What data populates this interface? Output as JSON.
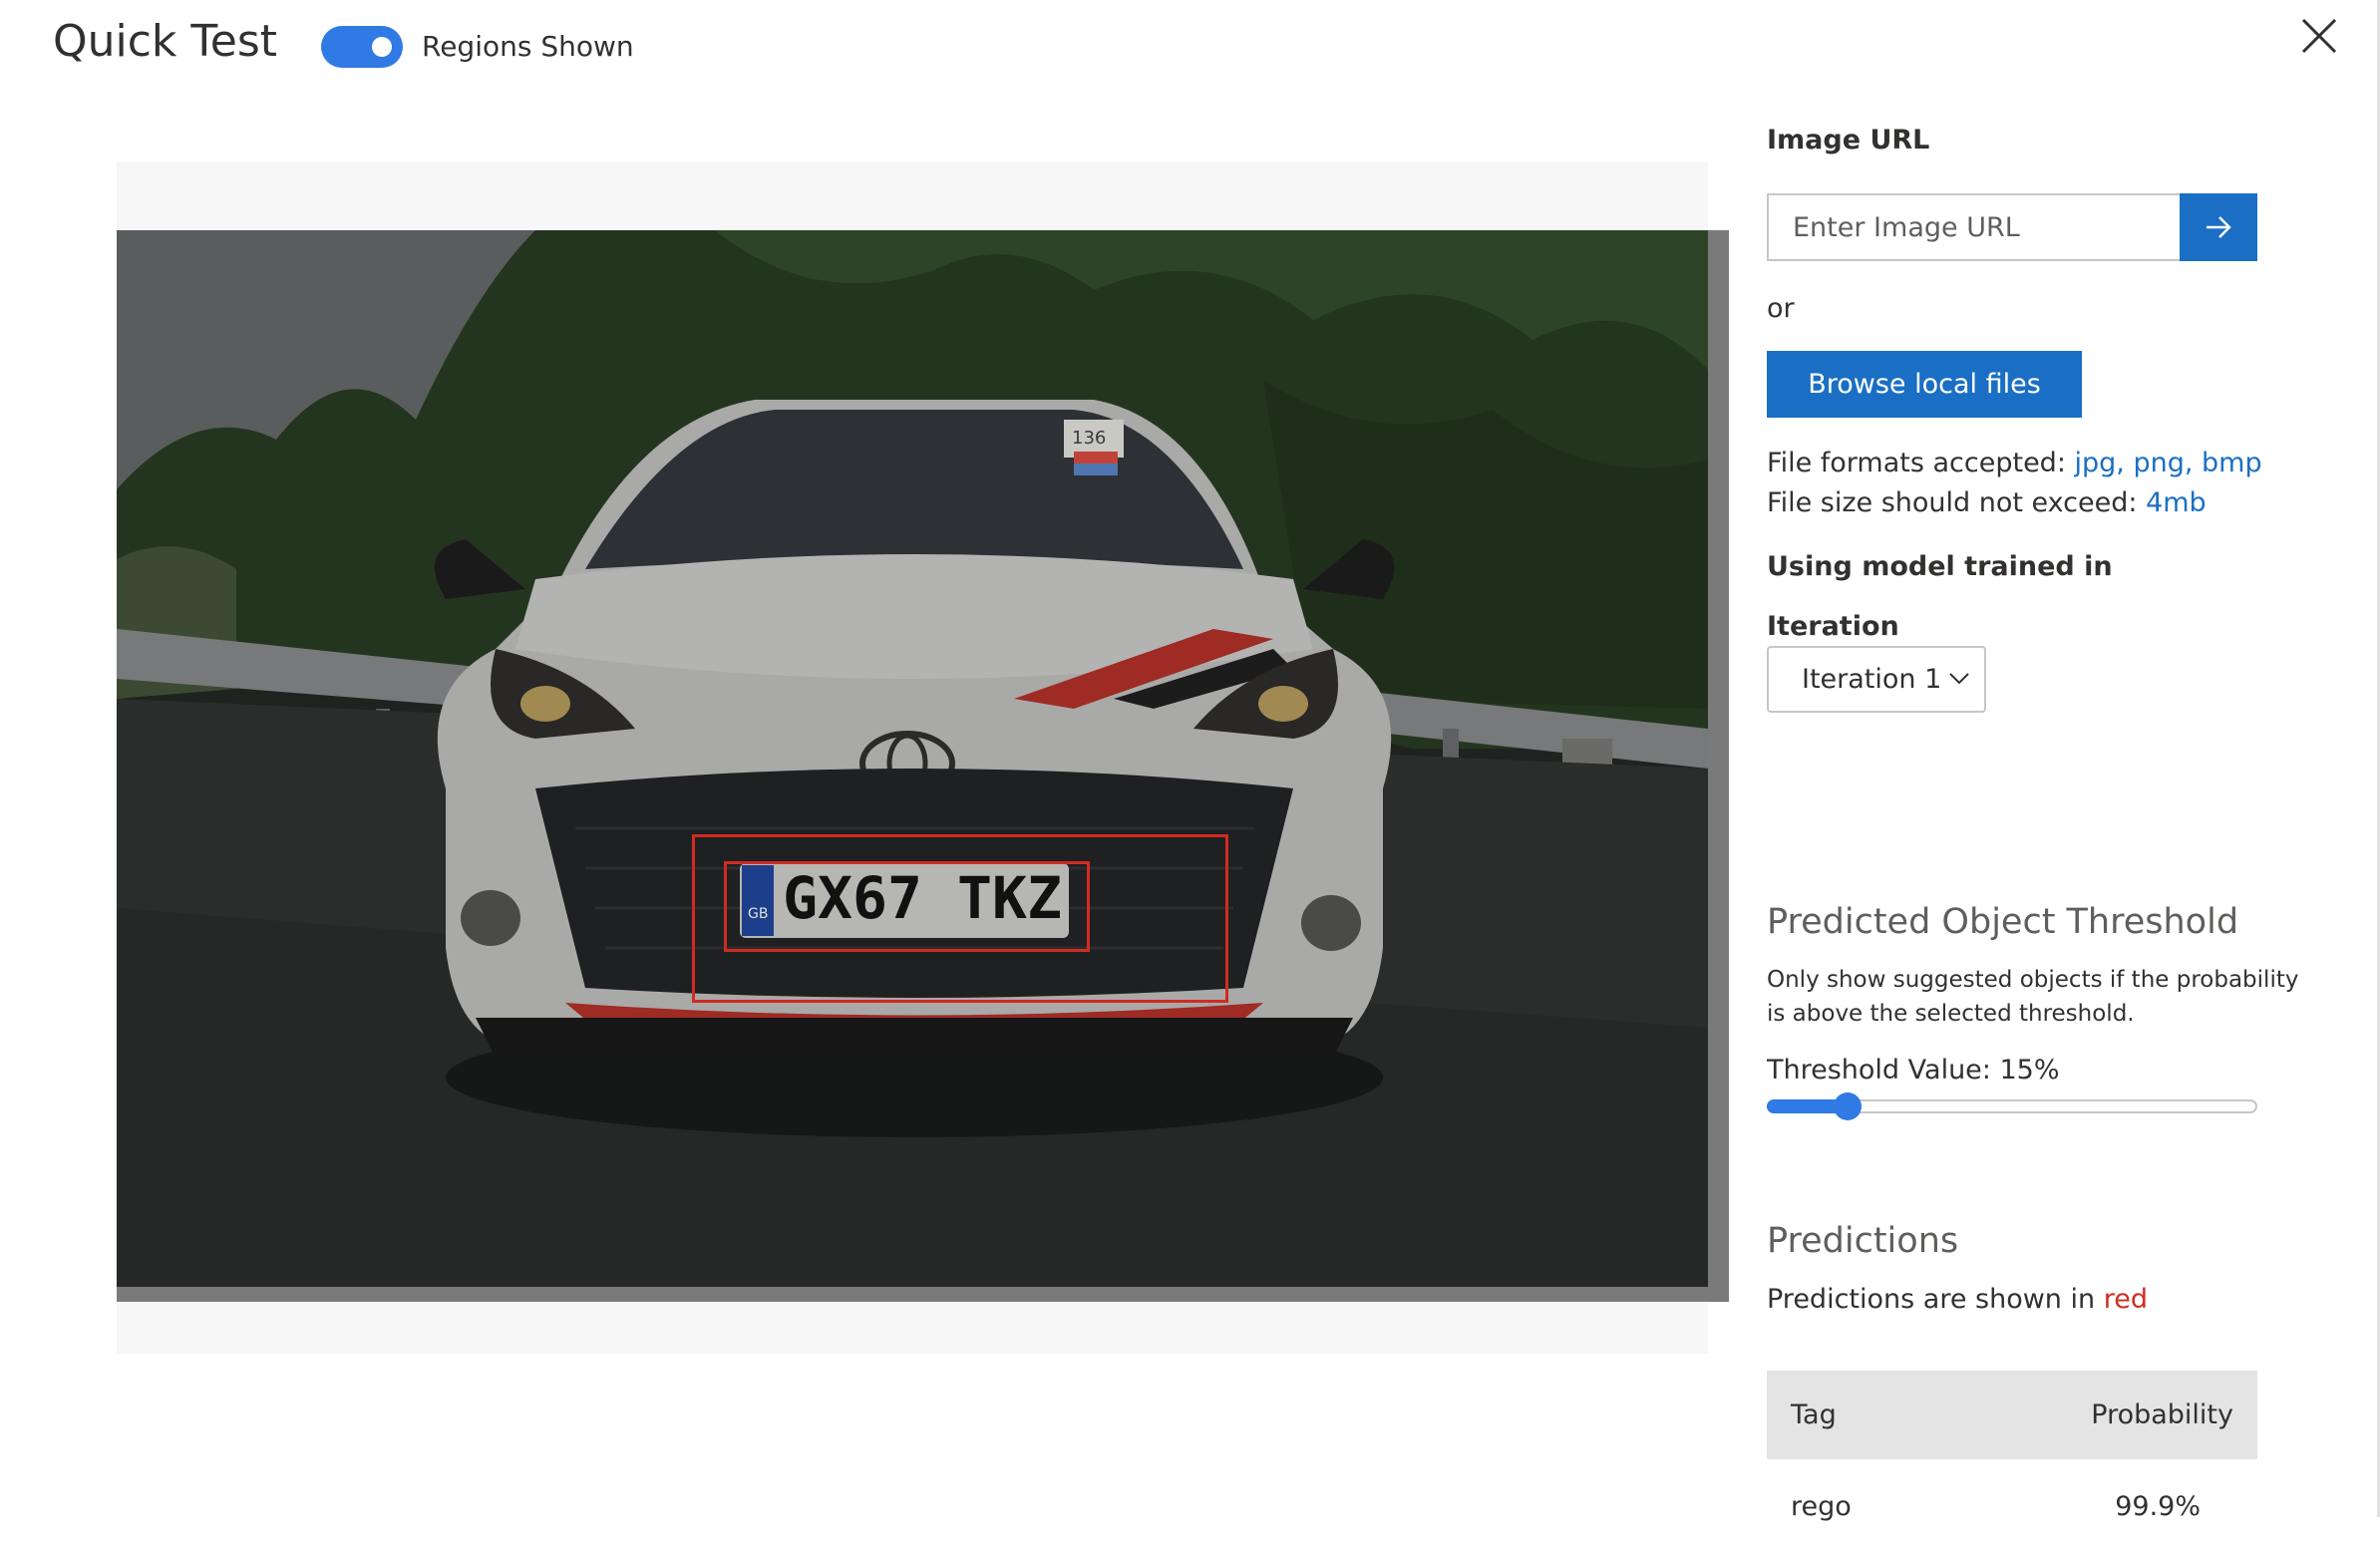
{
  "header": {
    "title": "Quick Test",
    "regions_toggle": {
      "label": "Regions Shown",
      "on": true
    }
  },
  "image": {
    "plate_text": "GX67 TKZ",
    "plate_country": "GB",
    "sticker_text": "136",
    "overlay_color": "#d22b22"
  },
  "right_panel": {
    "image_url_label": "Image URL",
    "image_url_placeholder": "Enter Image URL",
    "or_text": "or",
    "browse_button": "Browse local files",
    "file_formats_label": "File formats accepted:",
    "file_formats_value": "jpg, png, bmp",
    "file_size_label": "File size should not exceed:",
    "file_size_value": "4mb",
    "model_label": "Using model trained in",
    "iteration_label": "Iteration",
    "iteration_selected": "Iteration 1"
  },
  "threshold": {
    "heading": "Predicted Object Threshold",
    "description_line1": "Only show suggested objects if the probability",
    "description_line2": "is above the selected threshold.",
    "value_label": "Threshold Value: 15%",
    "value_percent": 15
  },
  "predictions": {
    "heading": "Predictions",
    "note_prefix": "Predictions are shown in",
    "note_color_word": "red",
    "columns": [
      "Tag",
      "Probability"
    ],
    "rows": [
      {
        "tag": "rego",
        "probability": "99.9%"
      }
    ]
  },
  "colors": {
    "accent_blue": "#1a6fc4",
    "toggle_blue": "#2f7ae5",
    "prediction_red": "#d22b22"
  }
}
